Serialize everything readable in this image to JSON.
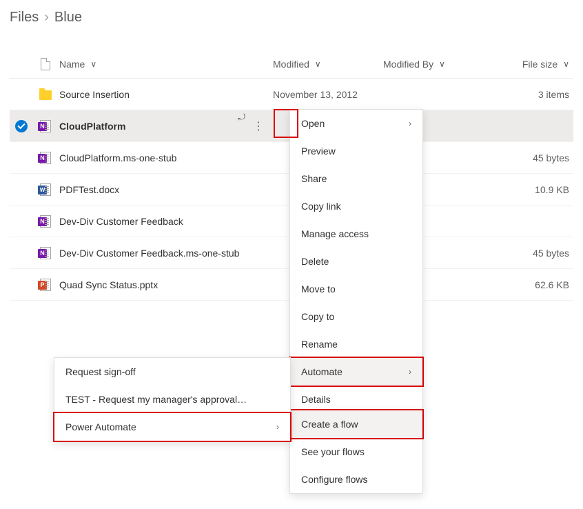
{
  "breadcrumb": {
    "root": "Files",
    "current": "Blue"
  },
  "columns": {
    "name": "Name",
    "modified": "Modified",
    "modified_by": "Modified By",
    "size": "File size"
  },
  "rows": [
    {
      "icon": "folder",
      "name": "Source Insertion",
      "modified": "November 13, 2012",
      "by": "",
      "size": "3 items"
    },
    {
      "icon": "onenote",
      "name": "CloudPlatform",
      "modified": "",
      "by": "",
      "size": "",
      "selected": true,
      "bold": true
    },
    {
      "icon": "onenote",
      "name": "CloudPlatform.ms-one-stub",
      "modified": "",
      "by": "",
      "size": "45 bytes"
    },
    {
      "icon": "word",
      "name": "PDFTest.docx",
      "modified": "",
      "by": "",
      "size": "10.9 KB"
    },
    {
      "icon": "onenote",
      "name": "Dev-Div Customer Feedback",
      "modified": "",
      "by": "",
      "size": ""
    },
    {
      "icon": "onenote",
      "name": "Dev-Div Customer Feedback.ms-one-stub",
      "modified": "",
      "by": "",
      "size": "45 bytes"
    },
    {
      "icon": "ppt",
      "name": "Quad Sync Status.pptx",
      "modified": "",
      "by": "",
      "size": "62.6 KB"
    }
  ],
  "context_menu": {
    "items": [
      {
        "label": "Open",
        "submenu": true
      },
      {
        "label": "Preview"
      },
      {
        "label": "Share"
      },
      {
        "label": "Copy link"
      },
      {
        "label": "Manage access"
      },
      {
        "label": "Delete"
      },
      {
        "label": "Move to"
      },
      {
        "label": "Copy to"
      },
      {
        "label": "Rename"
      },
      {
        "label": "Automate",
        "submenu": true,
        "hover": true,
        "highlight": true
      },
      {
        "label": "Details"
      }
    ]
  },
  "automate_submenu": {
    "items": [
      {
        "label": "Create a flow",
        "hover": true,
        "highlight": true
      },
      {
        "label": "See your flows"
      },
      {
        "label": "Configure flows"
      }
    ]
  },
  "pa_submenu": {
    "items": [
      {
        "label": "Request sign-off"
      },
      {
        "label": "TEST - Request my manager's approval…"
      },
      {
        "label": "Power Automate",
        "submenu": true,
        "highlight": true
      }
    ]
  }
}
